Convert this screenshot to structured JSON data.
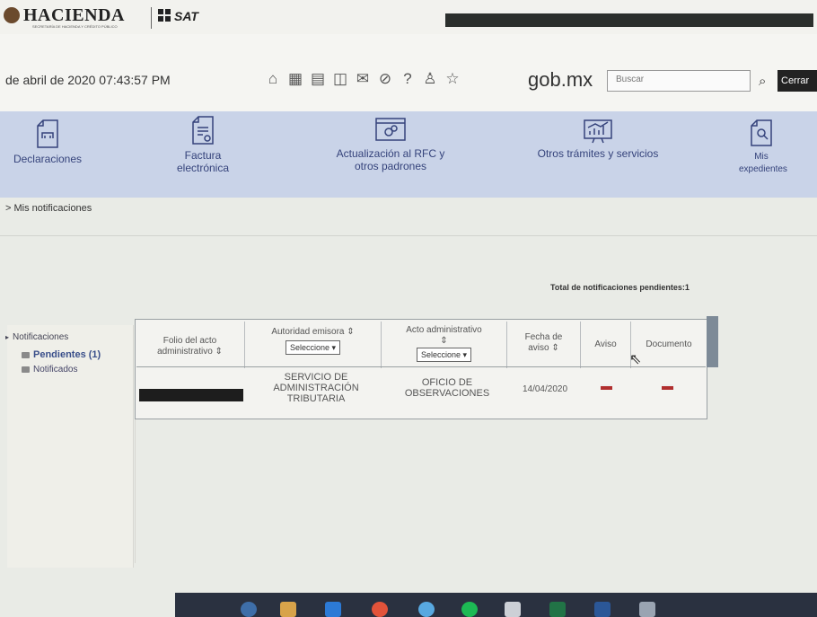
{
  "header": {
    "logo_text": "HACIENDA",
    "logo_subtitle": "SECRETARÍA DE HACIENDA Y CRÉDITO PÚBLICO",
    "sat_text": "SAT"
  },
  "info_bar": {
    "datetime": "de abril de 2020 07:43:57 PM",
    "icons": [
      "home-icon",
      "calendar-grid-icon",
      "calendar-icon",
      "book-icon",
      "mail-icon",
      "compass-icon",
      "help-icon",
      "user-icon",
      "star-icon"
    ],
    "brand": "gob.mx",
    "search_placeholder": "Buscar",
    "close_label": "Cerrar"
  },
  "nav": {
    "items": [
      {
        "label": "Declaraciones",
        "icon": "declaraciones-icon"
      },
      {
        "label": "Factura electrónica",
        "icon": "factura-icon"
      },
      {
        "label": "Actualización al RFC y otros padrones",
        "icon": "rfc-icon"
      },
      {
        "label": "Otros trámites y servicios",
        "icon": "tramites-icon"
      },
      {
        "label": "Mis expedientes",
        "icon": "expedientes-icon"
      }
    ]
  },
  "breadcrumb": "> Mis notificaciones",
  "total_pending": "Total de notificaciones pendientes:1",
  "side_tree": {
    "root": "Notificaciones",
    "pending": "Pendientes (1)",
    "notified": "Notificados"
  },
  "table": {
    "columns": [
      {
        "label": "Folio del acto administrativo",
        "sort": "⇕"
      },
      {
        "label": "Autoridad emisora",
        "sort": "⇕",
        "select": "Seleccione"
      },
      {
        "label": "Acto administrativo",
        "sort": "⇕",
        "select": "Seleccione"
      },
      {
        "label": "Fecha de aviso",
        "sort": "⇕"
      },
      {
        "label": "Aviso"
      },
      {
        "label": "Documento"
      }
    ],
    "rows": [
      {
        "folio": "",
        "authority": "SERVICIO DE ADMINISTRACIÓN TRIBUTARIA",
        "act": "OFICIO DE OBSERVACIONES",
        "date": "14/04/2020",
        "aviso_icon": "pdf-icon",
        "documento_icon": "pdf-icon"
      }
    ]
  }
}
